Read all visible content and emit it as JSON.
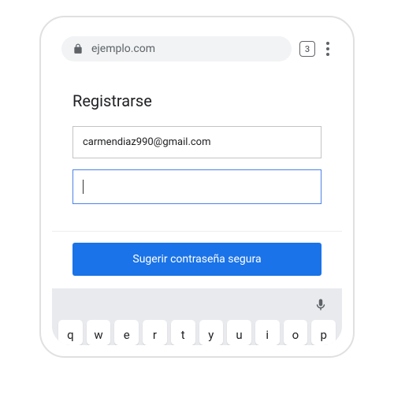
{
  "addressBar": {
    "url": "ejemplo.com",
    "tabCount": "3"
  },
  "page": {
    "heading": "Registrarse",
    "emailValue": "carmendiaz990@gmail.com",
    "passwordValue": ""
  },
  "suggestion": {
    "buttonLabel": "Sugerir contraseña segura"
  },
  "keyboard": {
    "row1": [
      "q",
      "w",
      "e",
      "r",
      "t",
      "y",
      "u",
      "i",
      "o",
      "p"
    ]
  }
}
